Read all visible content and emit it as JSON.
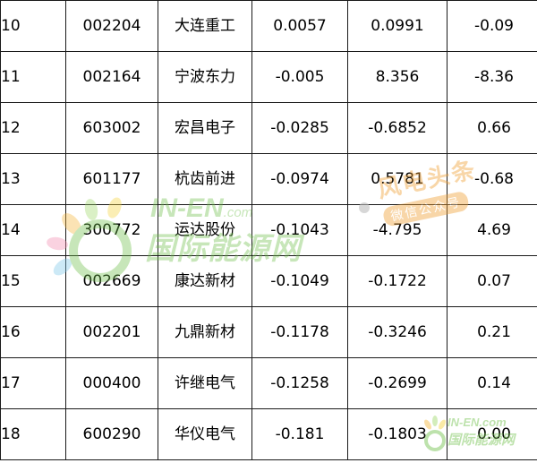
{
  "rows": [
    {
      "index": "10",
      "code": "002204",
      "name": "大连重工",
      "v1": "0.0057",
      "v2": "0.0991",
      "v3": "-0.09"
    },
    {
      "index": "11",
      "code": "002164",
      "name": "宁波东力",
      "v1": "-0.005",
      "v2": "8.356",
      "v3": "-8.36"
    },
    {
      "index": "12",
      "code": "603002",
      "name": "宏昌电子",
      "v1": "-0.0285",
      "v2": "-0.6852",
      "v3": "0.66"
    },
    {
      "index": "13",
      "code": "601177",
      "name": "杭齿前进",
      "v1": "-0.0974",
      "v2": "0.5781",
      "v3": "-0.68"
    },
    {
      "index": "14",
      "code": "300772",
      "name": "运达股份",
      "v1": "-0.1043",
      "v2": "-4.795",
      "v3": "4.69"
    },
    {
      "index": "15",
      "code": "002669",
      "name": "康达新材",
      "v1": "-0.1049",
      "v2": "-0.1722",
      "v3": "0.07"
    },
    {
      "index": "16",
      "code": "002201",
      "name": "九鼎新材",
      "v1": "-0.1178",
      "v2": "-0.3246",
      "v3": "0.21"
    },
    {
      "index": "17",
      "code": "000400",
      "name": "许继电气",
      "v1": "-0.1258",
      "v2": "-0.2699",
      "v3": "0.14"
    },
    {
      "index": "18",
      "code": "600290",
      "name": "华仪电气",
      "v1": "-0.181",
      "v2": "-0.1803",
      "v3": "0.00"
    }
  ],
  "watermark": {
    "logo_en": "IN-EN",
    "logo_com": ".com",
    "logo_cn": "国际能源网",
    "badge_title": "风电头条",
    "badge_sub": "微信公众号",
    "corner_en": "IN-EN.com",
    "corner_cn": "国际能源网",
    "colors": {
      "green": "#6fc04a",
      "orange": "#f0a033"
    }
  }
}
